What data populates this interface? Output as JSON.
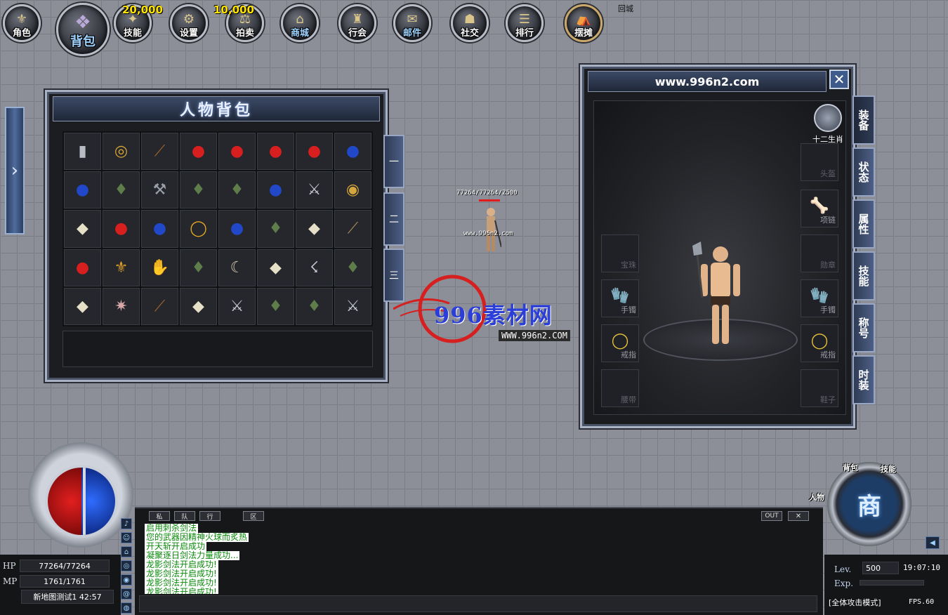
{
  "top_menu": {
    "items": [
      {
        "label": "角色",
        "icon": "character-icon"
      },
      {
        "label": "背包",
        "icon": "bag-icon"
      },
      {
        "label": "技能",
        "icon": "skill-icon",
        "badge": "20,000"
      },
      {
        "label": "设置",
        "icon": "gear-icon"
      },
      {
        "label": "拍卖",
        "icon": "auction-icon",
        "badge": "10,000"
      },
      {
        "label": "商城",
        "icon": "mall-icon"
      },
      {
        "label": "行会",
        "icon": "guild-icon"
      },
      {
        "label": "邮件",
        "icon": "mail-icon"
      },
      {
        "label": "社交",
        "icon": "social-icon"
      },
      {
        "label": "排行",
        "icon": "ranking-icon"
      },
      {
        "label": "摆摊",
        "icon": "stall-icon"
      }
    ],
    "return_city": "回城"
  },
  "bag": {
    "title": "人物背包",
    "tabs": [
      "一",
      "二",
      "三"
    ],
    "items": [
      "bar",
      "belt",
      "staff",
      "red-potion",
      "red-potion",
      "red-potion",
      "red-potion",
      "blue-potion",
      "blue-potion",
      "armor",
      "axe",
      "armor",
      "armor",
      "blue-potion",
      "sword",
      "ring",
      "boots",
      "red-potion",
      "blue-potion",
      "necklace",
      "blue-potion",
      "armor",
      "boots",
      "spear",
      "red-potion",
      "bracelet",
      "glove",
      "armor",
      "horn",
      "boots",
      "hook",
      "armor",
      "boots",
      "helmet",
      "staff",
      "boots",
      "sword",
      "armor",
      "armor",
      "sword"
    ]
  },
  "character": {
    "stats_label": "77264/77264/Z500",
    "name": "www.996n2.com"
  },
  "watermark": {
    "text": "996素材网",
    "url": "WWW.996n2.COM"
  },
  "equipment": {
    "title": "www.996n2.com",
    "zodiac_label": "十二生肖",
    "slots": {
      "helmet": "头盔",
      "necklace": "项链",
      "gem": "宝珠",
      "medal": "勋章",
      "bracelet_l": "手镯",
      "bracelet_r": "手镯",
      "ring_l": "戒指",
      "ring_r": "戒指",
      "belt": "腰带",
      "boots": "鞋子"
    },
    "tabs": [
      "装备",
      "状态",
      "属性",
      "技能",
      "称号",
      "时装"
    ]
  },
  "hud": {
    "hp_label": "HP",
    "hp_value": "77264/77264",
    "mp_label": "MP",
    "mp_value": "1761/1761",
    "map_line": "新地图测试1 42:57",
    "level_label": "Lev.",
    "level_value": "500",
    "exp_label": "Exp.",
    "clock": "19:07:10",
    "attack_mode": "[全体攻击模式]",
    "fps": "FPS.60",
    "shop_label": "商",
    "bag_shortcut": "背包",
    "skill_shortcut": "技能",
    "character_shortcut": "人物"
  },
  "chat": {
    "tools": [
      "私",
      "队",
      "行",
      "区"
    ],
    "out_label": "OUT",
    "close_label": "✕",
    "lines": [
      "启用刺杀剑法",
      "您的武器因精神火球而炙热",
      "开天斩开启成功",
      "凝聚逐日剑法力量成功...",
      "龙影剑法开启成功!",
      "龙影剑法开启成功!",
      "龙影剑法开启成功!",
      "龙影剑法开启成功!"
    ]
  },
  "colors": {
    "hp": "#e21f1f",
    "mp": "#2f6cff",
    "chat_text": "#0a8a0a",
    "badge": "#ffe400"
  }
}
